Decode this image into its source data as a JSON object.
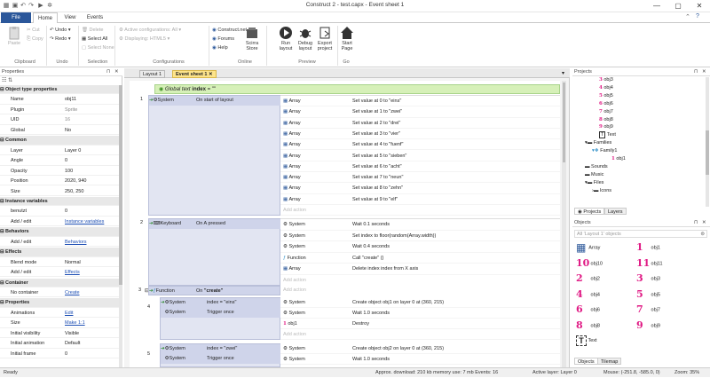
{
  "window": {
    "title": "Construct 2 - test.capx - Event sheet 1",
    "min": "—",
    "max": "▢",
    "close": "✕"
  },
  "ribbon_tabs": [
    "File",
    "Home",
    "View",
    "Events"
  ],
  "ribbon": {
    "paste": "Paste",
    "cut": "Cut",
    "copy": "Copy",
    "undo": "Undo",
    "redo": "Redo",
    "delete": "Delete",
    "select_all": "Select All",
    "select_none": "Select None",
    "active_conf": "Active configurations: All",
    "displaying": "Displaying: HTML5",
    "construct_net": "Construct.net",
    "forums": "Forums",
    "help": "Help",
    "scirra_store": "Scirra Store",
    "run_layout": "Run layout",
    "debug_layout": "Debug layout",
    "export_project": "Export project",
    "start_page": "Start Page",
    "groups": [
      "Clipboard",
      "Undo",
      "Selection",
      "Configurations",
      "Online",
      "Preview",
      "Go"
    ]
  },
  "properties": {
    "title": "Properties",
    "rows": [
      {
        "s": true,
        "k": "Object type properties"
      },
      {
        "k": "Name",
        "v": "obj11"
      },
      {
        "k": "Plugin",
        "v": "Sprite",
        "g": true
      },
      {
        "k": "UID",
        "v": "16",
        "g": true
      },
      {
        "k": "Global",
        "v": "No"
      },
      {
        "s": true,
        "k": "Common"
      },
      {
        "k": "Layer",
        "v": "Layer 0"
      },
      {
        "k": "Angle",
        "v": "0"
      },
      {
        "k": "Opacity",
        "v": "100"
      },
      {
        "k": "Position",
        "v": "2020, 940"
      },
      {
        "k": "Size",
        "v": "250, 250"
      },
      {
        "s": true,
        "k": "Instance variables"
      },
      {
        "k": "benutzt",
        "v": "0"
      },
      {
        "k": "Add / edit",
        "v": "Instance variables",
        "l": true
      },
      {
        "s": true,
        "k": "Behaviors"
      },
      {
        "k": "Add / edit",
        "v": "Behaviors",
        "l": true
      },
      {
        "s": true,
        "k": "Effects"
      },
      {
        "k": "Blend mode",
        "v": "Normal"
      },
      {
        "k": "Add / edit",
        "v": "Effects",
        "l": true
      },
      {
        "s": true,
        "k": "Container"
      },
      {
        "k": "No container",
        "v": "Create",
        "l": true
      },
      {
        "s": true,
        "k": "Properties"
      },
      {
        "k": "Animations",
        "v": "Edit",
        "l": true
      },
      {
        "k": "Size",
        "v": "Make 1:1",
        "l": true
      },
      {
        "k": "Initial visibility",
        "v": "Visible"
      },
      {
        "k": "Initial animation",
        "v": "Default"
      },
      {
        "k": "Initial frame",
        "v": "0"
      }
    ]
  },
  "tabs": {
    "layout": "Layout 1",
    "event_sheet": "Event sheet 1"
  },
  "events": {
    "global": "Global text index = \"\"",
    "global_prefix": "Global text",
    "global_name": "index",
    "global_value": "= \"\"",
    "e1": {
      "num": "1",
      "obj": "System",
      "cond": "On start of layout",
      "actions": [
        {
          "o": "Array",
          "t": "Set value at 0 to \"eins\""
        },
        {
          "o": "Array",
          "t": "Set value at 1 to \"zwei\""
        },
        {
          "o": "Array",
          "t": "Set value at 2 to \"drei\""
        },
        {
          "o": "Array",
          "t": "Set value at 3 to \"vier\""
        },
        {
          "o": "Array",
          "t": "Set value at 4 to \"fuenf\""
        },
        {
          "o": "Array",
          "t": "Set value at 5 to \"sieben\""
        },
        {
          "o": "Array",
          "t": "Set value at 6 to \"acht\""
        },
        {
          "o": "Array",
          "t": "Set value at 7 to \"neun\""
        },
        {
          "o": "Array",
          "t": "Set value at 8 to \"zehn\""
        },
        {
          "o": "Array",
          "t": "Set value at 9 to \"elf\""
        }
      ]
    },
    "e2": {
      "num": "2",
      "obj": "Keyboard",
      "cond": "On A pressed",
      "actions": [
        {
          "o": "System",
          "t": "Wait 0.1 seconds"
        },
        {
          "o": "System",
          "t": "Set index to floor(random(Array.width))"
        },
        {
          "o": "System",
          "t": "Wait 0.4 seconds"
        },
        {
          "o": "Function",
          "t": "Call \"create\" ()"
        },
        {
          "o": "Array",
          "t": "Delete index index from X axis"
        }
      ]
    },
    "e3": {
      "num": "3",
      "obj": "Function",
      "cond": "On \"create\""
    },
    "e4": {
      "num": "4",
      "c1o": "System",
      "c1": "index = \"eins\"",
      "c2o": "System",
      "c2": "Trigger once",
      "actions": [
        {
          "o": "System",
          "t": "Create object obj1 on layer 0 at (360, 215)"
        },
        {
          "o": "System",
          "t": "Wait 1.0 seconds"
        },
        {
          "o": "obj1",
          "t": "Destroy"
        }
      ]
    },
    "e5": {
      "num": "5",
      "c1o": "System",
      "c1": "index = \"zwei\"",
      "c2o": "System",
      "c2": "Trigger once",
      "actions": [
        {
          "o": "System",
          "t": "Create object obj2 on layer 0 at (360, 215)"
        },
        {
          "o": "System",
          "t": "Wait 1.0 seconds"
        }
      ]
    },
    "add_action": "Add action"
  },
  "projects": {
    "title": "Projects",
    "items": [
      "obj3",
      "obj4",
      "obj5",
      "obj6",
      "obj7",
      "obj8",
      "obj9",
      "Text",
      "Families",
      "Family1",
      "obj1",
      "Sounds",
      "Music",
      "Files",
      "Icons"
    ],
    "tabs": [
      "Projects",
      "Layers"
    ]
  },
  "objects": {
    "title": "Objects",
    "filter": "All 'Layout 1' objects",
    "items": [
      "Array",
      "obj1",
      "obj10",
      "obj11",
      "obj2",
      "obj3",
      "obj4",
      "obj5",
      "obj6",
      "obj7",
      "obj8",
      "obj9",
      "Text"
    ],
    "tabs": [
      "Objects",
      "Tilemap"
    ]
  },
  "status": {
    "ready": "Ready",
    "download": "Approx. download: 210 kb  memory use: 7 mb  Events: 16",
    "layer": "Active layer: Layer 0",
    "mouse": "Mouse: (-251.8, -585.0, 0)",
    "zoom": "Zoom: 35%"
  },
  "colors": {
    "accent": "#2b579a",
    "tab_active": "#fde48b",
    "global_bar": "#d6f0b8",
    "event_bg": "#e2e5f2",
    "cond_bg": "#cfd4ea",
    "link": "#1e4fb4",
    "hand_pink": "#e01b85"
  }
}
